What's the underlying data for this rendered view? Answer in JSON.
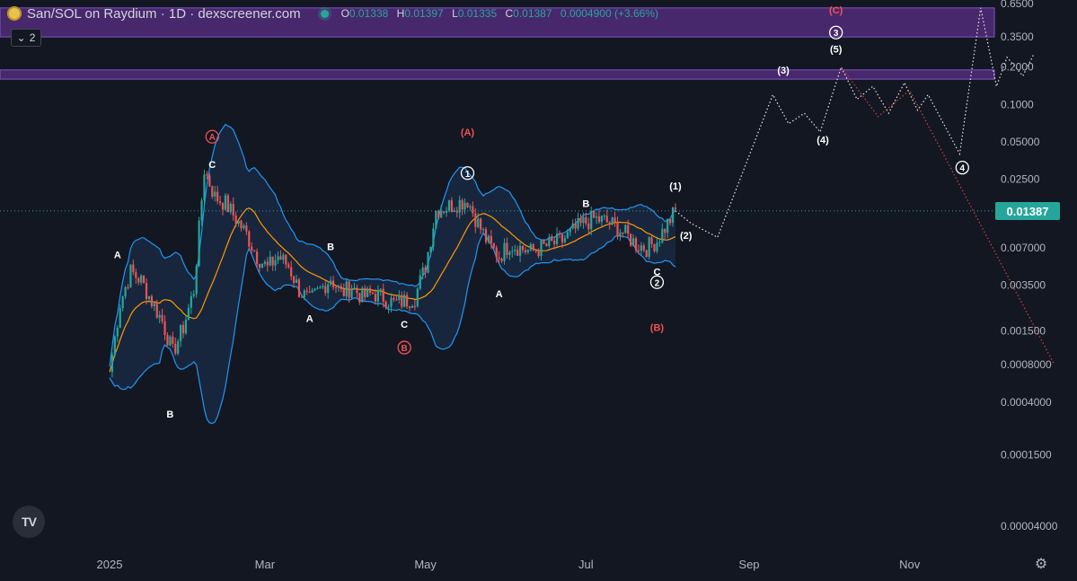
{
  "header": {
    "title": "San/SOL on Raydium · 1D · dexscreener.com",
    "ohlc": [
      {
        "k": "O",
        "v": "0.01338"
      },
      {
        "k": "H",
        "v": "0.01397"
      },
      {
        "k": "L",
        "v": "0.01335"
      },
      {
        "k": "C",
        "v": "0.01387"
      }
    ],
    "change": "0.0004900 (+3.66%)",
    "indicator_count": "2"
  },
  "last_price": "0.01387",
  "brand_label": "TV",
  "colors": {
    "background": "#131722",
    "up": "#26a69a",
    "down": "#ef5350",
    "band": "#2196f3",
    "ma": "#ff9800",
    "zone": "#5b2f86",
    "red_label": "#ef5350"
  },
  "chart_data": {
    "type": "line",
    "scale": "log",
    "ylim": [
      4e-05,
      0.65
    ],
    "y_ticks": [
      "0.6500",
      "0.3500",
      "0.2000",
      "0.1000",
      "0.05000",
      "0.02500",
      "0.007000",
      "0.003500",
      "0.001500",
      "0.0008000",
      "0.0004000",
      "0.0001500",
      "0.00004000"
    ],
    "x_ticks": [
      "2025",
      "Mar",
      "May",
      "Jul",
      "Sep",
      "Nov"
    ],
    "price": {
      "dates": [
        "2025-01-01",
        "2025-01-05",
        "2025-01-09",
        "2025-01-13",
        "2025-01-17",
        "2025-01-21",
        "2025-01-25",
        "2025-01-29",
        "2025-02-02",
        "2025-02-06",
        "2025-02-10",
        "2025-02-14",
        "2025-02-18",
        "2025-02-22",
        "2025-02-26",
        "2025-03-02",
        "2025-03-06",
        "2025-03-10",
        "2025-03-14",
        "2025-03-18",
        "2025-03-22",
        "2025-03-26",
        "2025-03-30",
        "2025-04-03",
        "2025-04-07",
        "2025-04-11",
        "2025-04-15",
        "2025-04-19",
        "2025-04-23",
        "2025-04-27",
        "2025-05-01",
        "2025-05-05",
        "2025-05-09",
        "2025-05-13",
        "2025-05-17",
        "2025-05-21",
        "2025-05-25",
        "2025-05-29",
        "2025-06-02",
        "2025-06-06",
        "2025-06-10",
        "2025-06-14",
        "2025-06-18",
        "2025-06-22",
        "2025-06-26",
        "2025-06-30",
        "2025-07-04",
        "2025-07-08",
        "2025-07-12",
        "2025-07-16",
        "2025-07-20",
        "2025-07-24",
        "2025-07-28",
        "2025-08-01",
        "2025-08-04"
      ],
      "close": [
        0.0007,
        0.0025,
        0.0045,
        0.0038,
        0.0026,
        0.0018,
        0.001,
        0.0016,
        0.0032,
        0.03,
        0.018,
        0.016,
        0.012,
        0.009,
        0.006,
        0.0048,
        0.006,
        0.005,
        0.0032,
        0.0026,
        0.0032,
        0.004,
        0.003,
        0.0034,
        0.0028,
        0.003,
        0.0028,
        0.0025,
        0.0026,
        0.0028,
        0.005,
        0.014,
        0.015,
        0.016,
        0.017,
        0.011,
        0.0075,
        0.006,
        0.0075,
        0.007,
        0.0065,
        0.007,
        0.0075,
        0.008,
        0.0095,
        0.011,
        0.012,
        0.0115,
        0.0105,
        0.009,
        0.0075,
        0.007,
        0.008,
        0.011,
        0.01387
      ]
    },
    "projection": [
      {
        "date": "2025-08-04",
        "value": 0.0139
      },
      {
        "date": "2025-08-10",
        "value": 0.011
      },
      {
        "date": "2025-08-20",
        "value": 0.0085
      },
      {
        "date": "2025-09-10",
        "value": 0.12
      },
      {
        "date": "2025-09-16",
        "value": 0.07
      },
      {
        "date": "2025-09-22",
        "value": 0.085
      },
      {
        "date": "2025-09-28",
        "value": 0.06
      },
      {
        "date": "2025-10-06",
        "value": 0.2
      },
      {
        "date": "2025-10-12",
        "value": 0.11
      },
      {
        "date": "2025-10-18",
        "value": 0.14
      },
      {
        "date": "2025-10-24",
        "value": 0.085
      },
      {
        "date": "2025-10-30",
        "value": 0.15
      },
      {
        "date": "2025-11-04",
        "value": 0.09
      },
      {
        "date": "2025-11-08",
        "value": 0.12
      },
      {
        "date": "2025-11-20",
        "value": 0.04
      },
      {
        "date": "2025-11-28",
        "value": 0.6
      },
      {
        "date": "2025-12-04",
        "value": 0.14
      },
      {
        "date": "2025-12-08",
        "value": 0.24
      },
      {
        "date": "2025-12-14",
        "value": 0.17
      },
      {
        "date": "2025-12-18",
        "value": 0.25
      }
    ],
    "projection_alt": [
      {
        "date": "2025-10-06",
        "value": 0.2
      },
      {
        "date": "2025-10-20",
        "value": 0.08
      },
      {
        "date": "2025-11-01",
        "value": 0.13
      },
      {
        "date": "2025-12-26",
        "value": 0.0008
      }
    ],
    "zones": [
      {
        "from": 0.35,
        "to": 0.6
      },
      {
        "from": 0.16,
        "to": 0.19
      }
    ],
    "labels": [
      {
        "text": "A",
        "date": "2025-01-04",
        "value": 0.0062,
        "style": "plain"
      },
      {
        "text": "B",
        "date": "2025-01-24",
        "value": 0.00032,
        "style": "plain"
      },
      {
        "text": "C",
        "date": "2025-02-09",
        "value": 0.033,
        "style": "plain"
      },
      {
        "text": "A",
        "date": "2025-02-09",
        "value": 0.055,
        "style": "red-circle"
      },
      {
        "text": "A",
        "date": "2025-03-18",
        "value": 0.0019,
        "style": "plain"
      },
      {
        "text": "B",
        "date": "2025-03-26",
        "value": 0.0072,
        "style": "plain"
      },
      {
        "text": "C",
        "date": "2025-04-23",
        "value": 0.0017,
        "style": "plain"
      },
      {
        "text": "B",
        "date": "2025-04-23",
        "value": 0.0011,
        "style": "red-circle"
      },
      {
        "text": "(A)",
        "date": "2025-05-17",
        "value": 0.06,
        "style": "red"
      },
      {
        "text": "1",
        "date": "2025-05-17",
        "value": 0.028,
        "style": "white-circle"
      },
      {
        "text": "A",
        "date": "2025-05-29",
        "value": 0.003,
        "style": "plain"
      },
      {
        "text": "B",
        "date": "2025-07-01",
        "value": 0.016,
        "style": "plain"
      },
      {
        "text": "C",
        "date": "2025-07-28",
        "value": 0.0045,
        "style": "plain"
      },
      {
        "text": "2",
        "date": "2025-07-28",
        "value": 0.0037,
        "style": "white-circle"
      },
      {
        "text": "(B)",
        "date": "2025-07-28",
        "value": 0.0016,
        "style": "red"
      },
      {
        "text": "(1)",
        "date": "2025-08-04",
        "value": 0.022,
        "style": "plain"
      },
      {
        "text": "(2)",
        "date": "2025-08-08",
        "value": 0.0088,
        "style": "plain"
      },
      {
        "text": "(3)",
        "date": "2025-09-14",
        "value": 0.19,
        "style": "plain"
      },
      {
        "text": "(4)",
        "date": "2025-09-29",
        "value": 0.052,
        "style": "plain"
      },
      {
        "text": "(5)",
        "date": "2025-10-04",
        "value": 0.28,
        "style": "plain"
      },
      {
        "text": "3",
        "date": "2025-10-04",
        "value": 0.38,
        "style": "white-circle"
      },
      {
        "text": "(C)",
        "date": "2025-10-04",
        "value": 0.58,
        "style": "red"
      },
      {
        "text": "4",
        "date": "2025-11-21",
        "value": 0.031,
        "style": "white-circle"
      }
    ]
  }
}
